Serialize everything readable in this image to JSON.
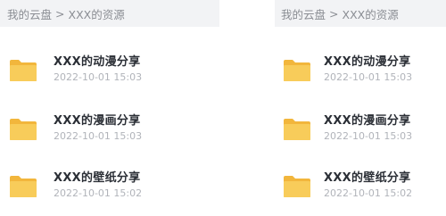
{
  "panels": [
    {
      "breadcrumb": {
        "root": "我的云盘",
        "separator": ">",
        "current": "XXX的资源"
      },
      "files": [
        {
          "name": "XXX的动漫分享",
          "date": "2022-10-01 15:03",
          "icon": "folder-icon"
        },
        {
          "name": "XXX的漫画分享",
          "date": "2022-10-01 15:03",
          "icon": "folder-icon"
        },
        {
          "name": "XXX的壁纸分享",
          "date": "2022-10-01 15:02",
          "icon": "folder-icon"
        }
      ]
    },
    {
      "breadcrumb": {
        "root": "我的云盘",
        "separator": ">",
        "current": "XXX的资源"
      },
      "files": [
        {
          "name": "XXX的动漫分享",
          "date": "2022-10-01 15:03",
          "icon": "folder-icon"
        },
        {
          "name": "XXX的漫画分享",
          "date": "2022-10-01 15:03",
          "icon": "folder-icon"
        },
        {
          "name": "XXX的壁纸分享",
          "date": "2022-10-01 15:02",
          "icon": "folder-icon"
        }
      ]
    }
  ],
  "colors": {
    "folder_back": "#f2b63c",
    "folder_front": "#f8cc5a",
    "breadcrumb_bg": "#f2f3f5",
    "title_text": "#2b2f36",
    "date_text": "#b1b4ba"
  }
}
